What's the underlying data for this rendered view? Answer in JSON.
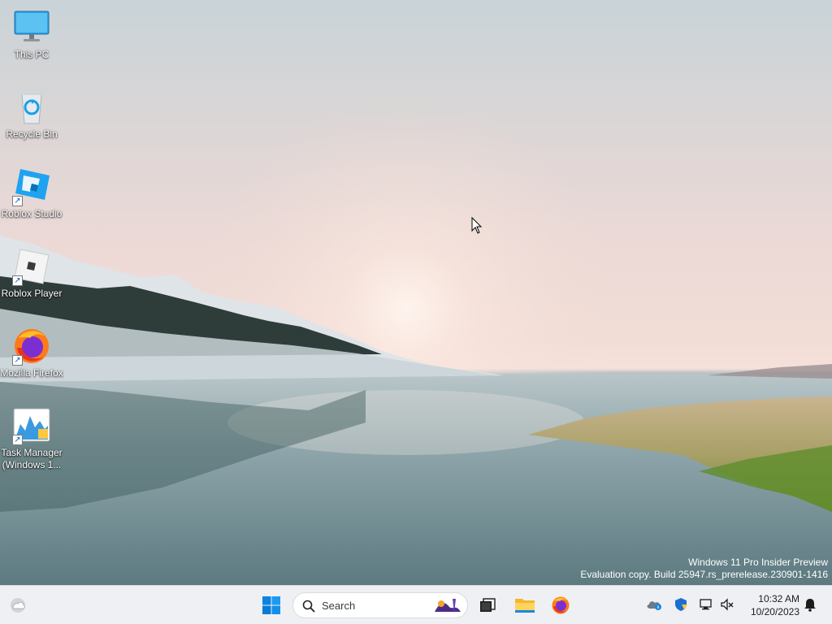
{
  "desktop": {
    "icons": [
      {
        "label": "This PC",
        "icon": "monitor-icon"
      },
      {
        "label": "Recycle Bin",
        "icon": "recycle-bin-icon"
      },
      {
        "label": "Roblox Studio",
        "icon": "roblox-studio-icon"
      },
      {
        "label": "Roblox Player",
        "icon": "roblox-player-icon"
      },
      {
        "label": "Mozilla Firefox",
        "icon": "firefox-icon"
      },
      {
        "label": "Task Manager (Windows 1...",
        "icon": "task-manager-icon"
      }
    ],
    "watermark": {
      "line1": "Windows 11 Pro Insider Preview",
      "line2": "Evaluation copy. Build 25947.rs_prerelease.230901-1416"
    }
  },
  "taskbar": {
    "widgets_icon": "weather-widget-icon",
    "start_icon": "windows-start-icon",
    "search": {
      "placeholder": "Search"
    },
    "pinned": [
      "task-view-icon",
      "file-explorer-icon",
      "firefox-icon"
    ],
    "tray": [
      "onedrive-icon",
      "security-icon",
      "network-icon",
      "volume-muted-icon"
    ],
    "clock": {
      "time": "10:32 AM",
      "date": "10/20/2023"
    },
    "notification_icon": "bell-icon"
  },
  "colors": {
    "accent": "#0078d4",
    "taskbar_bg": "#eef0f3",
    "desktop_text": "#ffffff"
  }
}
